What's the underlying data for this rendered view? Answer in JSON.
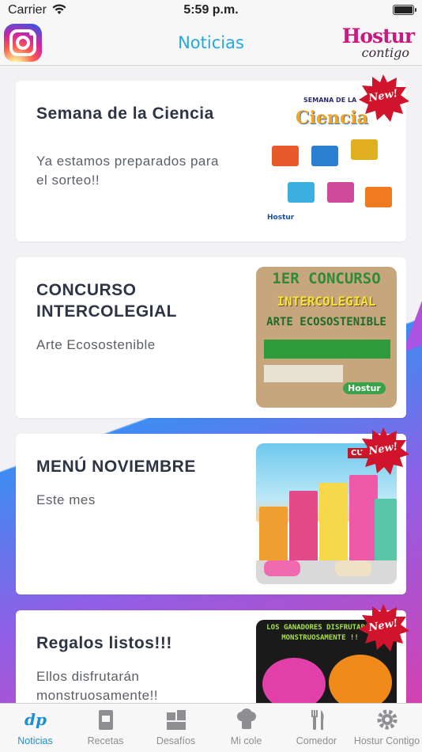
{
  "status_bar": {
    "carrier": "Carrier",
    "time": "5:59 p.m."
  },
  "nav": {
    "title": "Noticias",
    "logo_main": "Hostur",
    "logo_sub": "contigo",
    "instagram_icon": "instagram-icon"
  },
  "cards": [
    {
      "title": "Semana de la Ciencia",
      "subtitle": "Ya estamos preparados para el sorteo!!",
      "badge": "New!",
      "thumb": {
        "word": "Ciencia",
        "small": "SEMANA DE LA",
        "footer": "Hostur"
      }
    },
    {
      "title": "CONCURSO INTERCOLEGIAL",
      "subtitle": "Arte Ecosostenible",
      "badge": "",
      "thumb": {
        "line1": "1ER CONCURSO",
        "line2": "INTERCOLEGIAL",
        "line3": "ARTE ECOSOSTENIBLE",
        "footer": "Hostur"
      }
    },
    {
      "title": "MENÚ NOVIEMBRE",
      "subtitle": "Este mes",
      "badge": "New!",
      "thumb": {
        "sign": "CUBA"
      }
    },
    {
      "title": "Regalos listos!!!",
      "subtitle": "Ellos disfrutarán monstruosamente!!",
      "badge": "New!",
      "thumb": {
        "text": "LOS GANADORES DISFRUTARÁN MONSTRUOSAMENTE !!"
      }
    }
  ],
  "tabs": [
    {
      "label": "Noticias",
      "icon": "news-icon",
      "active": true
    },
    {
      "label": "Recetas",
      "icon": "recipe-book-icon",
      "active": false
    },
    {
      "label": "Desafíos",
      "icon": "puzzle-icon",
      "active": false
    },
    {
      "label": "Mi cole",
      "icon": "chef-hat-icon",
      "active": false
    },
    {
      "label": "Comedor",
      "icon": "fork-knife-icon",
      "active": false
    },
    {
      "label": "Hostur Contigo",
      "icon": "gear-icon",
      "active": false
    }
  ],
  "colors": {
    "accent": "#23a8e0",
    "active_tab": "#1c8fd6",
    "inactive_tab": "#8e8e93",
    "brand": "#c8197e",
    "badge_red": "#d0142c"
  }
}
